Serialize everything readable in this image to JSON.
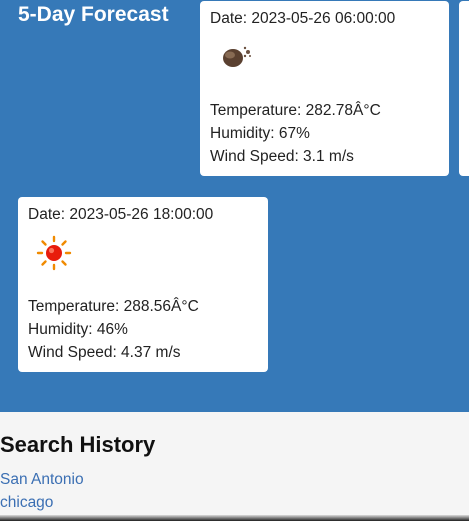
{
  "forecast": {
    "title": "5-Day Forecast",
    "cards": [
      {
        "date": "Date: 2023-05-26 06:00:00",
        "icon": "overcast-clouds-icon",
        "temperature": "Temperature: 282.78Â°C",
        "humidity": "Humidity: 67%",
        "wind": "Wind Speed: 3.1 m/s"
      },
      {
        "date": "Date: 2023-05-26 18:00:00",
        "icon": "clear-sky-sun-icon",
        "temperature": "Temperature: 288.56Â°C",
        "humidity": "Humidity: 46%",
        "wind": "Wind Speed: 4.37 m/s"
      }
    ]
  },
  "history": {
    "title": "Search History",
    "items": [
      "San Antonio",
      "chicago"
    ]
  },
  "colors": {
    "panel": "#3679b8",
    "link": "#3b6fb3",
    "card": "#ffffff"
  }
}
